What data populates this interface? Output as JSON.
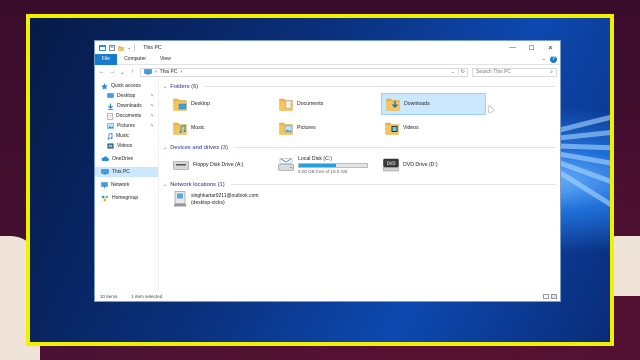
{
  "window": {
    "title": "This PC",
    "controls": {
      "minimize": "—",
      "maximize": "☐",
      "close": "✕"
    }
  },
  "ribbon": {
    "tabs": [
      "File",
      "Computer",
      "View"
    ],
    "chevron": "⌄",
    "help": "?"
  },
  "address": {
    "back": "←",
    "forward": "→",
    "recent": "⌄",
    "up": "↑",
    "sep": "›",
    "path": "This PC",
    "dropdown": "⌄",
    "refresh": "↻",
    "search_placeholder": "Search This PC",
    "search_icon": "⌕"
  },
  "nav": {
    "items": [
      {
        "label": "Quick access",
        "icon": "star-icon",
        "level": 0
      },
      {
        "label": "Desktop",
        "icon": "desktop-icon",
        "level": 1,
        "pinned": true
      },
      {
        "label": "Downloads",
        "icon": "download-icon",
        "level": 1,
        "pinned": true
      },
      {
        "label": "Documents",
        "icon": "document-icon",
        "level": 1,
        "pinned": true
      },
      {
        "label": "Pictures",
        "icon": "pictures-icon",
        "level": 1,
        "pinned": true
      },
      {
        "label": "Music",
        "icon": "music-icon",
        "level": 1
      },
      {
        "label": "Videos",
        "icon": "video-icon",
        "level": 1
      },
      {
        "label": "OneDrive",
        "icon": "cloud-icon",
        "level": 0
      },
      {
        "label": "This PC",
        "icon": "computer-icon",
        "level": 0,
        "selected": true
      },
      {
        "label": "Network",
        "icon": "network-icon",
        "level": 0
      },
      {
        "label": "Homegroup",
        "icon": "homegroup-icon",
        "level": 0
      }
    ],
    "pin_glyph": "✎"
  },
  "groups": {
    "folders": {
      "title": "Folders (6)",
      "items": [
        "Desktop",
        "Documents",
        "Downloads",
        "Music",
        "Pictures",
        "Videos"
      ],
      "hovered": "Downloads"
    },
    "devices": {
      "title": "Devices and drives (3)",
      "floppy": "Floppy Disk Drive (A:)",
      "local": {
        "name": "Local Disk (C:)",
        "free": "9.00 GB free of 19.5 GB",
        "used_fraction": 0.54
      },
      "dvd": "DVD Drive (D:)",
      "dvd_logo": "DVD"
    },
    "network": {
      "title": "Network locations (1)",
      "line1": "singhkartar9211@outlook.com",
      "line2": "(desktop-vicks)"
    },
    "chevron": "⌄"
  },
  "status": {
    "count": "10 items",
    "selected": "1 item selected"
  },
  "colors": {
    "frame": "#f0f000",
    "accent": "#1979ca",
    "folder": "#f6c55a",
    "selection": "#cce8ff",
    "drive_bar": "#26a0da"
  }
}
